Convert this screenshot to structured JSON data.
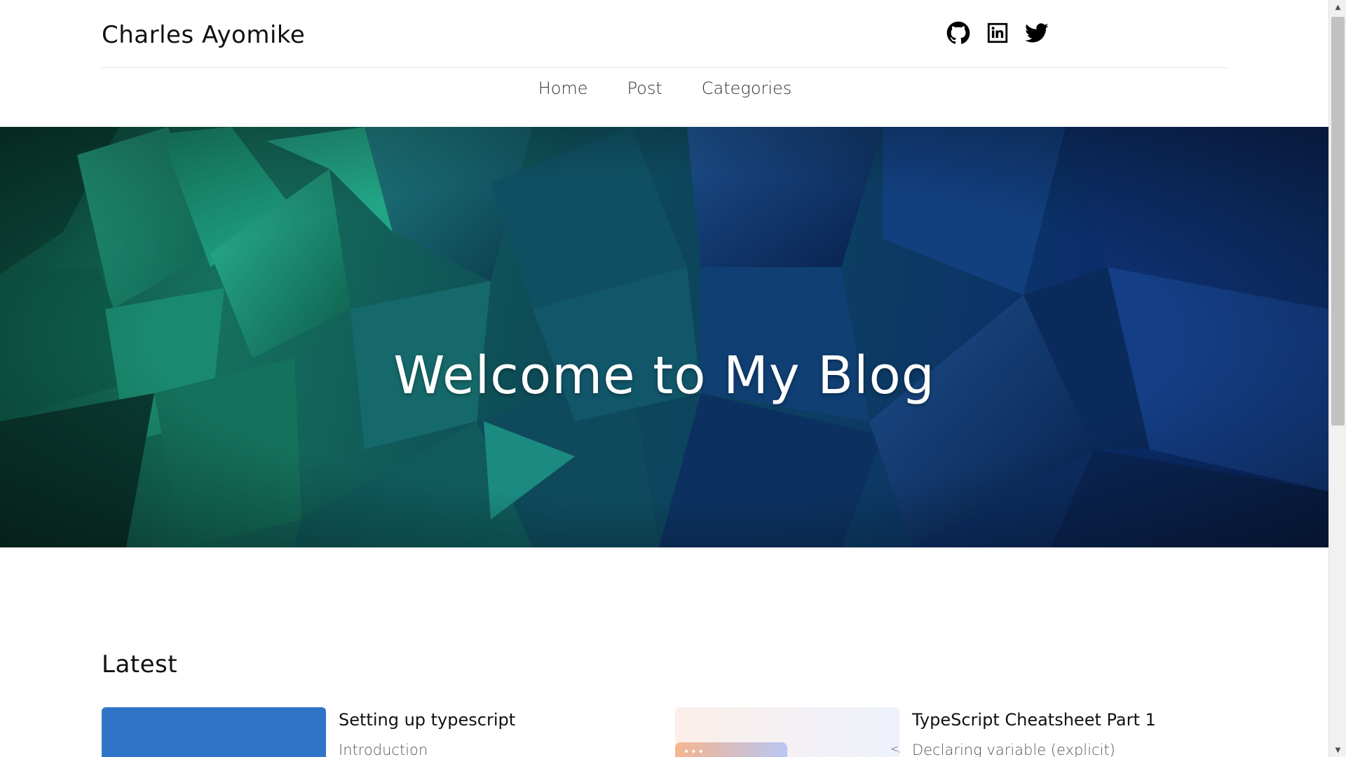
{
  "header": {
    "brand": "Charles Ayomike",
    "social": [
      {
        "icon": "github-icon"
      },
      {
        "icon": "linkedin-icon"
      },
      {
        "icon": "twitter-icon"
      }
    ]
  },
  "nav": {
    "items": [
      {
        "label": "Home"
      },
      {
        "label": "Post"
      },
      {
        "label": "Categories"
      }
    ]
  },
  "hero": {
    "title": "Welcome to My Blog"
  },
  "latest": {
    "heading": "Latest",
    "posts": [
      {
        "title": "Setting up typescript",
        "excerpt": "Introduction",
        "thumb_color": "#3074c8"
      },
      {
        "title": "TypeScript Cheatsheet Part 1",
        "excerpt": "Declaring variable (explicit)",
        "thumb_color": "#f3eef4"
      }
    ]
  },
  "colors": {
    "hero_green": "#15705c",
    "hero_blue": "#0b2a6e",
    "accent_blue": "#3074c8"
  }
}
